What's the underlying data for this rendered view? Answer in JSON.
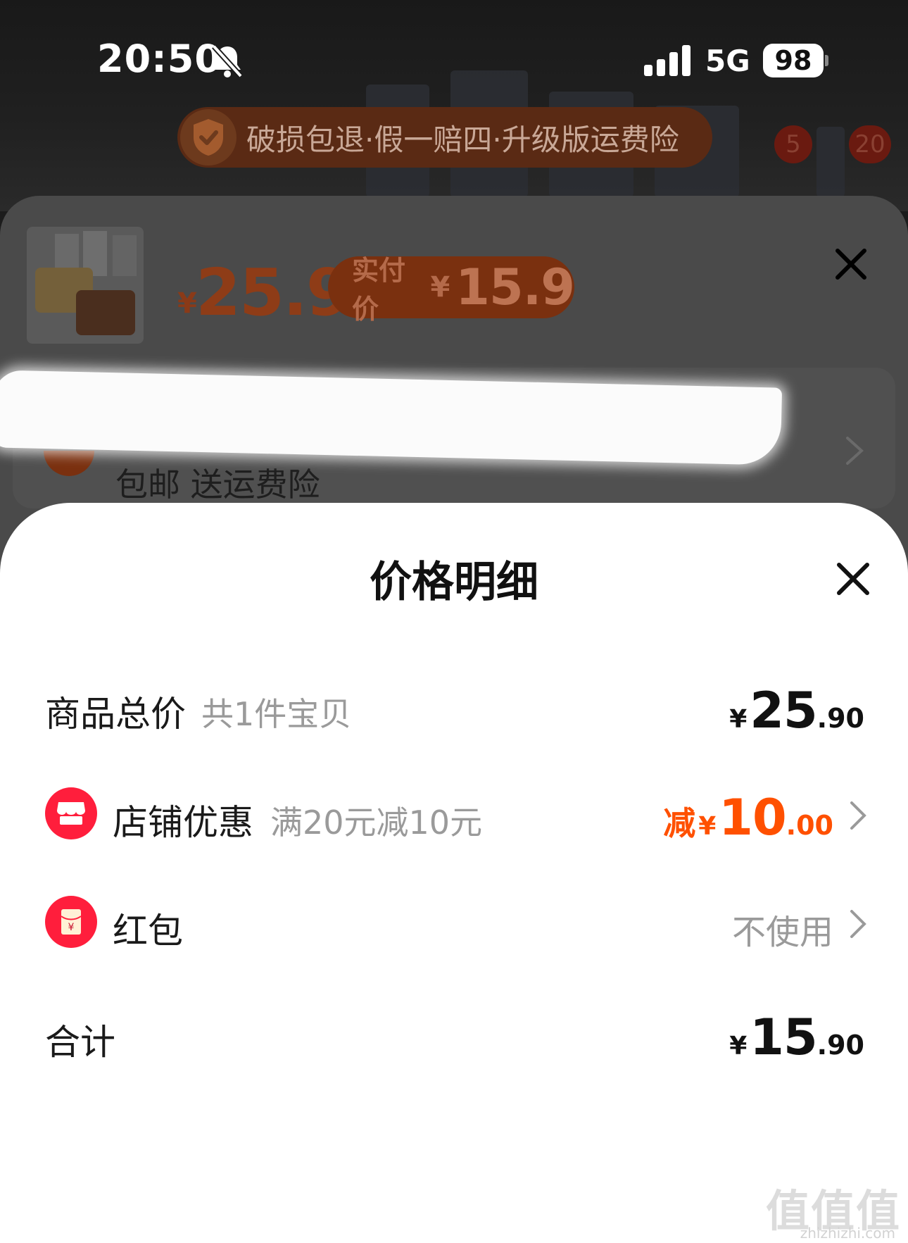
{
  "status_bar": {
    "time": "20:50",
    "network": "5G",
    "battery": "98"
  },
  "guarantee": {
    "text": "破损包退·假一赔四·升级版运费险",
    "badges": [
      "5",
      "20"
    ]
  },
  "product_sheet": {
    "price_yen": "¥",
    "price": "25.9",
    "paid_label": "实付价",
    "paid_yen": "¥",
    "paid_price": "15.9",
    "shipping_text": "包邮 送运费险"
  },
  "price_detail": {
    "title": "价格明细",
    "rows": {
      "goods_total": {
        "label": "商品总价",
        "sub": "共1件宝贝",
        "yen": "¥",
        "int": "25",
        "dec": ".90"
      },
      "store_discount": {
        "label": "店铺优惠",
        "sub": "满20元减10元",
        "prefix": "减",
        "yen": "¥",
        "int": "10",
        "dec": ".00"
      },
      "red_packet": {
        "label": "红包",
        "value": "不使用"
      },
      "total": {
        "label": "合计",
        "yen": "¥",
        "int": "15",
        "dec": ".90"
      }
    }
  },
  "watermark": {
    "main": "值值值",
    "domain": "zhizhizhi.com"
  },
  "colors": {
    "accent": "#ff5000",
    "icon_red": "#ff1e3c",
    "sheet_bg": "#ffffff"
  },
  "icons": [
    "bell-muted-icon",
    "signal-icon",
    "shield-check-icon",
    "close-icon",
    "chevron-right-icon",
    "store-icon",
    "red-packet-icon"
  ]
}
